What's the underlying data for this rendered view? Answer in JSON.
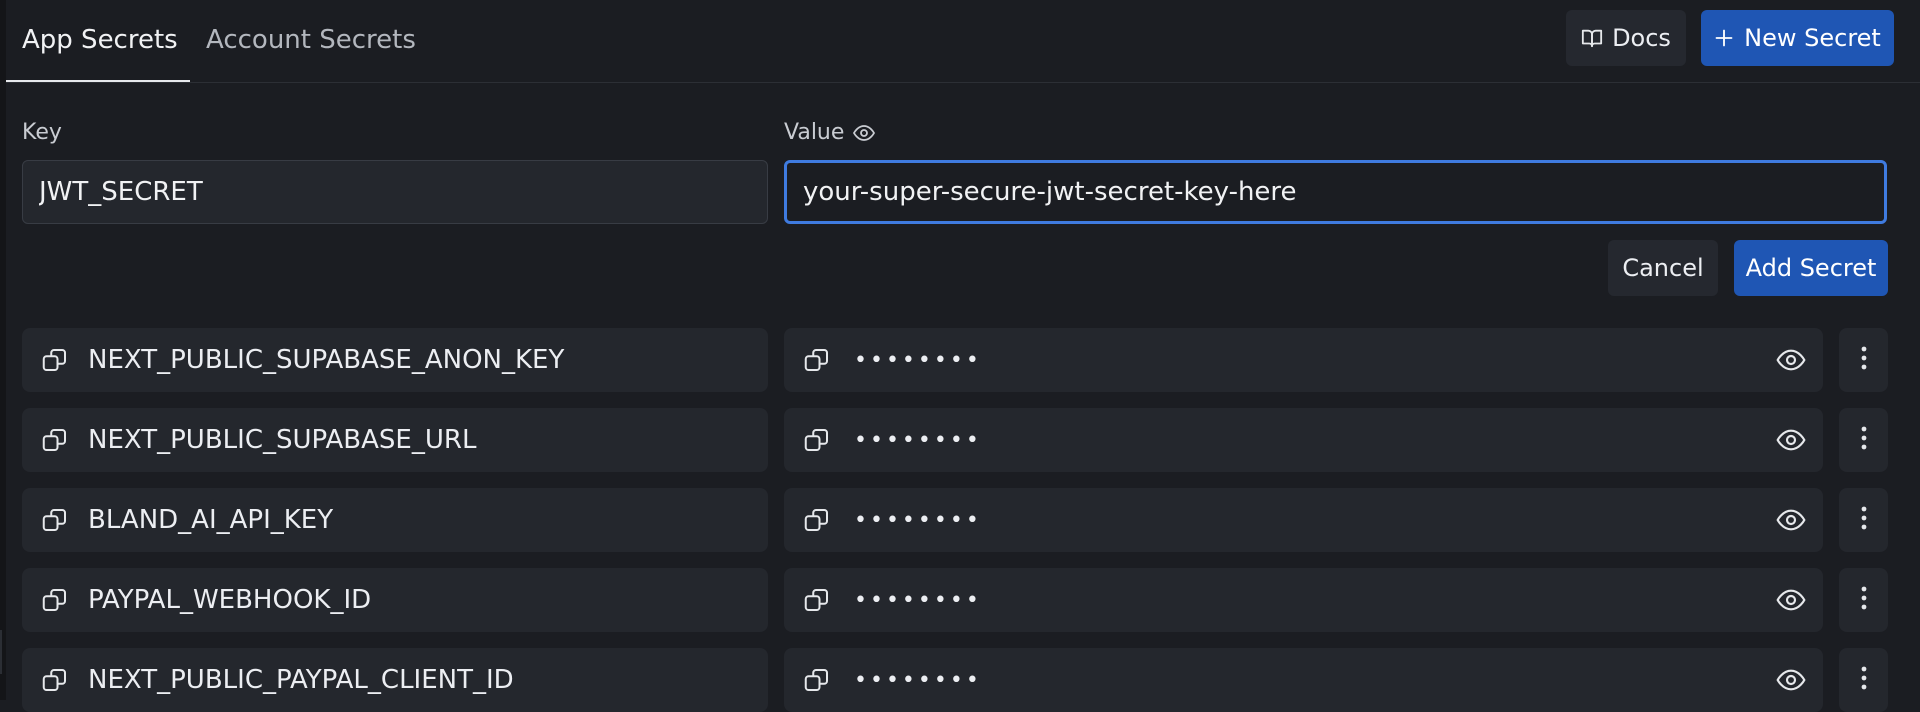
{
  "tabs": [
    {
      "label": "App Secrets",
      "active": true
    },
    {
      "label": "Account Secrets",
      "active": false
    }
  ],
  "header": {
    "docs_label": "Docs",
    "new_secret_label": "New Secret"
  },
  "form": {
    "key_label": "Key",
    "value_label": "Value",
    "key_value": "JWT_SECRET",
    "value_value": "your-super-secure-jwt-secret-key-here",
    "cancel_label": "Cancel",
    "add_label": "Add Secret"
  },
  "secrets": [
    {
      "key": "NEXT_PUBLIC_SUPABASE_ANON_KEY",
      "masked": "••••••••"
    },
    {
      "key": "NEXT_PUBLIC_SUPABASE_URL",
      "masked": "••••••••"
    },
    {
      "key": "BLAND_AI_API_KEY",
      "masked": "••••••••"
    },
    {
      "key": "PAYPAL_WEBHOOK_ID",
      "masked": "••••••••"
    },
    {
      "key": "NEXT_PUBLIC_PAYPAL_CLIENT_ID",
      "masked": "••••••••"
    }
  ],
  "colors": {
    "background": "#1b1d22",
    "surface": "#24272d",
    "accent": "#1f56b4",
    "focus": "#3f7be0"
  },
  "icons": {
    "docs": "book-open-icon",
    "new": "plus-icon",
    "copy": "copy-icon",
    "reveal": "eye-icon",
    "menu": "more-vertical-icon"
  }
}
